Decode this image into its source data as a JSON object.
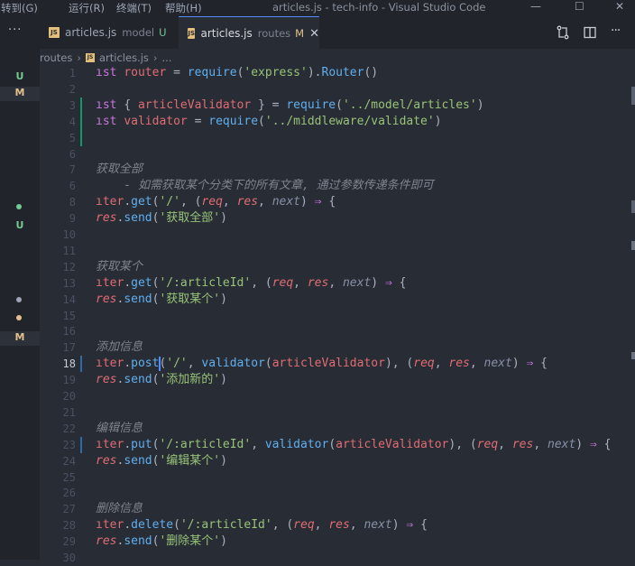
{
  "titlebar": {
    "menus": [
      "转到(G)",
      "运行(R)",
      "终端(T)",
      "帮助(H)"
    ],
    "title": "articles.js - tech-info - Visual Studio Code",
    "controls": [
      "—",
      "☐",
      "✕"
    ]
  },
  "tabs": [
    {
      "badge": "JS",
      "name": "articles.js",
      "folder": "model",
      "status": "U",
      "status_color": "#73c991"
    },
    {
      "badge": "JS",
      "name": "articles.js",
      "folder": "routes",
      "status": "M",
      "status_color": "#e2c08d",
      "close": "✕"
    }
  ],
  "tabbar": {
    "more": "···",
    "icons": [
      "compare-changes-icon",
      "split-editor-icon",
      "more-actions-icon"
    ]
  },
  "breadcrumb": {
    "folder": "routes",
    "badge": "JS",
    "file": "articles.js",
    "tail": "..."
  },
  "sidebar": {
    "git_badges": [
      "U",
      "M",
      "U",
      "M"
    ]
  },
  "colors": {
    "added_bar": "#109868",
    "modified_bar": "#2c6ba8",
    "cursor": "#528bff"
  },
  "editor": {
    "active_line": 18,
    "lines": [
      {
        "n": "1",
        "gutter": "",
        "tokens": [
          {
            "c": "kw",
            "t": "ıst "
          },
          {
            "c": "vr",
            "t": "router"
          },
          {
            "c": "",
            "t": " = "
          },
          {
            "c": "fn",
            "t": "require"
          },
          {
            "c": "",
            "t": "("
          },
          {
            "c": "st",
            "t": "'express'"
          },
          {
            "c": "",
            "t": ")."
          },
          {
            "c": "fn",
            "t": "Router"
          },
          {
            "c": "",
            "t": "()"
          }
        ]
      },
      {
        "n": "2",
        "gutter": "",
        "tokens": []
      },
      {
        "n": "3",
        "gutter": "added",
        "tokens": [
          {
            "c": "kw",
            "t": "ıst "
          },
          {
            "c": "",
            "t": "{ "
          },
          {
            "c": "vr",
            "t": "articleValidator"
          },
          {
            "c": "",
            "t": " } = "
          },
          {
            "c": "fn",
            "t": "require"
          },
          {
            "c": "",
            "t": "("
          },
          {
            "c": "st",
            "t": "'../model/articles'"
          },
          {
            "c": "",
            "t": ")"
          }
        ]
      },
      {
        "n": "4",
        "gutter": "added",
        "tokens": [
          {
            "c": "kw",
            "t": "ıst "
          },
          {
            "c": "vr",
            "t": "validator"
          },
          {
            "c": "",
            "t": " = "
          },
          {
            "c": "fn",
            "t": "require"
          },
          {
            "c": "",
            "t": "("
          },
          {
            "c": "st",
            "t": "'../middleware/validate'"
          },
          {
            "c": "",
            "t": ")"
          }
        ]
      },
      {
        "n": "5",
        "gutter": "added",
        "tokens": []
      },
      {
        "n": "6",
        "gutter": "",
        "tokens": []
      },
      {
        "n": "7",
        "gutter": "",
        "tokens": [
          {
            "c": "cm",
            "t": "获取全部"
          }
        ]
      },
      {
        "n": "6",
        "gutter": "",
        "tokens": [
          {
            "c": "cm",
            "t": "    - 如需获取某个分类下的所有文章, 通过参数传递条件即可"
          }
        ]
      },
      {
        "n": "8",
        "gutter": "",
        "tokens": [
          {
            "c": "vr",
            "t": "ıter"
          },
          {
            "c": "",
            "t": "."
          },
          {
            "c": "fn",
            "t": "get"
          },
          {
            "c": "",
            "t": "("
          },
          {
            "c": "st",
            "t": "'/'"
          },
          {
            "c": "",
            "t": ", ("
          },
          {
            "c": "pm",
            "t": "req"
          },
          {
            "c": "",
            "t": ", "
          },
          {
            "c": "pm",
            "t": "res"
          },
          {
            "c": "",
            "t": ", "
          },
          {
            "c": "pm2",
            "t": "next"
          },
          {
            "c": "",
            "t": ") "
          },
          {
            "c": "ar",
            "t": "⇒"
          },
          {
            "c": "",
            "t": " {"
          }
        ]
      },
      {
        "n": "9",
        "gutter": "",
        "tokens": [
          {
            "c": "pm",
            "t": "res"
          },
          {
            "c": "",
            "t": "."
          },
          {
            "c": "fn",
            "t": "send"
          },
          {
            "c": "",
            "t": "("
          },
          {
            "c": "st",
            "t": "'获取全部'"
          },
          {
            "c": "",
            "t": ")"
          }
        ]
      },
      {
        "n": "10",
        "gutter": "",
        "tokens": []
      },
      {
        "n": "11",
        "gutter": "",
        "tokens": []
      },
      {
        "n": "12",
        "gutter": "",
        "tokens": [
          {
            "c": "cm",
            "t": "获取某个"
          }
        ]
      },
      {
        "n": "13",
        "gutter": "",
        "tokens": [
          {
            "c": "vr",
            "t": "ıter"
          },
          {
            "c": "",
            "t": "."
          },
          {
            "c": "fn",
            "t": "get"
          },
          {
            "c": "",
            "t": "("
          },
          {
            "c": "st",
            "t": "'/:articleId'"
          },
          {
            "c": "",
            "t": ", ("
          },
          {
            "c": "pm",
            "t": "req"
          },
          {
            "c": "",
            "t": ", "
          },
          {
            "c": "pm",
            "t": "res"
          },
          {
            "c": "",
            "t": ", "
          },
          {
            "c": "pm2",
            "t": "next"
          },
          {
            "c": "",
            "t": ") "
          },
          {
            "c": "ar",
            "t": "⇒"
          },
          {
            "c": "",
            "t": " {"
          }
        ]
      },
      {
        "n": "14",
        "gutter": "",
        "tokens": [
          {
            "c": "pm",
            "t": "res"
          },
          {
            "c": "",
            "t": "."
          },
          {
            "c": "fn",
            "t": "send"
          },
          {
            "c": "",
            "t": "("
          },
          {
            "c": "st",
            "t": "'获取某个'"
          },
          {
            "c": "",
            "t": ")"
          }
        ]
      },
      {
        "n": "15",
        "gutter": "",
        "tokens": []
      },
      {
        "n": "16",
        "gutter": "",
        "tokens": []
      },
      {
        "n": "17",
        "gutter": "",
        "tokens": [
          {
            "c": "cm",
            "t": "添加信息"
          }
        ]
      },
      {
        "n": "18",
        "gutter": "modified",
        "tokens": [
          {
            "c": "vr",
            "t": "ıter"
          },
          {
            "c": "",
            "t": "."
          },
          {
            "c": "fn",
            "t": "post"
          },
          {
            "c": "",
            "t": "("
          },
          {
            "c": "st",
            "t": "'/'"
          },
          {
            "c": "",
            "t": ", "
          },
          {
            "c": "fn",
            "t": "validator"
          },
          {
            "c": "",
            "t": "("
          },
          {
            "c": "vr",
            "t": "articleValidator"
          },
          {
            "c": "",
            "t": "), ("
          },
          {
            "c": "pm",
            "t": "req"
          },
          {
            "c": "",
            "t": ", "
          },
          {
            "c": "pm",
            "t": "res"
          },
          {
            "c": "",
            "t": ", "
          },
          {
            "c": "pm2",
            "t": "next"
          },
          {
            "c": "",
            "t": ") "
          },
          {
            "c": "ar",
            "t": "⇒"
          },
          {
            "c": "",
            "t": " {"
          }
        ]
      },
      {
        "n": "19",
        "gutter": "",
        "tokens": [
          {
            "c": "pm",
            "t": "res"
          },
          {
            "c": "",
            "t": "."
          },
          {
            "c": "fn",
            "t": "send"
          },
          {
            "c": "",
            "t": "("
          },
          {
            "c": "st",
            "t": "'添加新的'"
          },
          {
            "c": "",
            "t": ")"
          }
        ]
      },
      {
        "n": "20",
        "gutter": "",
        "tokens": []
      },
      {
        "n": "21",
        "gutter": "",
        "tokens": []
      },
      {
        "n": "22",
        "gutter": "",
        "tokens": [
          {
            "c": "cm",
            "t": "编辑信息"
          }
        ]
      },
      {
        "n": "23",
        "gutter": "modified",
        "tokens": [
          {
            "c": "vr",
            "t": "ıter"
          },
          {
            "c": "",
            "t": "."
          },
          {
            "c": "fn",
            "t": "put"
          },
          {
            "c": "",
            "t": "("
          },
          {
            "c": "st",
            "t": "'/:articleId'"
          },
          {
            "c": "",
            "t": ", "
          },
          {
            "c": "fn",
            "t": "validator"
          },
          {
            "c": "",
            "t": "("
          },
          {
            "c": "vr",
            "t": "articleValidator"
          },
          {
            "c": "",
            "t": "), ("
          },
          {
            "c": "pm",
            "t": "req"
          },
          {
            "c": "",
            "t": ", "
          },
          {
            "c": "pm",
            "t": "res"
          },
          {
            "c": "",
            "t": ", "
          },
          {
            "c": "pm2",
            "t": "next"
          },
          {
            "c": "",
            "t": ") "
          },
          {
            "c": "ar",
            "t": "⇒"
          },
          {
            "c": "",
            "t": " {"
          }
        ]
      },
      {
        "n": "24",
        "gutter": "",
        "tokens": [
          {
            "c": "pm",
            "t": "res"
          },
          {
            "c": "",
            "t": "."
          },
          {
            "c": "fn",
            "t": "send"
          },
          {
            "c": "",
            "t": "("
          },
          {
            "c": "st",
            "t": "'编辑某个'"
          },
          {
            "c": "",
            "t": ")"
          }
        ]
      },
      {
        "n": "25",
        "gutter": "",
        "tokens": []
      },
      {
        "n": "26",
        "gutter": "",
        "tokens": []
      },
      {
        "n": "27",
        "gutter": "",
        "tokens": [
          {
            "c": "cm",
            "t": "删除信息"
          }
        ]
      },
      {
        "n": "28",
        "gutter": "",
        "tokens": [
          {
            "c": "vr",
            "t": "ıter"
          },
          {
            "c": "",
            "t": "."
          },
          {
            "c": "fn",
            "t": "delete"
          },
          {
            "c": "",
            "t": "("
          },
          {
            "c": "st",
            "t": "'/:articleId'"
          },
          {
            "c": "",
            "t": ", ("
          },
          {
            "c": "pm",
            "t": "req"
          },
          {
            "c": "",
            "t": ", "
          },
          {
            "c": "pm",
            "t": "res"
          },
          {
            "c": "",
            "t": ", "
          },
          {
            "c": "pm2",
            "t": "next"
          },
          {
            "c": "",
            "t": ") "
          },
          {
            "c": "ar",
            "t": "⇒"
          },
          {
            "c": "",
            "t": " {"
          }
        ]
      },
      {
        "n": "29",
        "gutter": "",
        "tokens": [
          {
            "c": "pm",
            "t": "res"
          },
          {
            "c": "",
            "t": "."
          },
          {
            "c": "fn",
            "t": "send"
          },
          {
            "c": "",
            "t": "("
          },
          {
            "c": "st",
            "t": "'删除某个'"
          },
          {
            "c": "",
            "t": ")"
          }
        ]
      },
      {
        "n": "30",
        "gutter": "",
        "tokens": []
      }
    ]
  }
}
